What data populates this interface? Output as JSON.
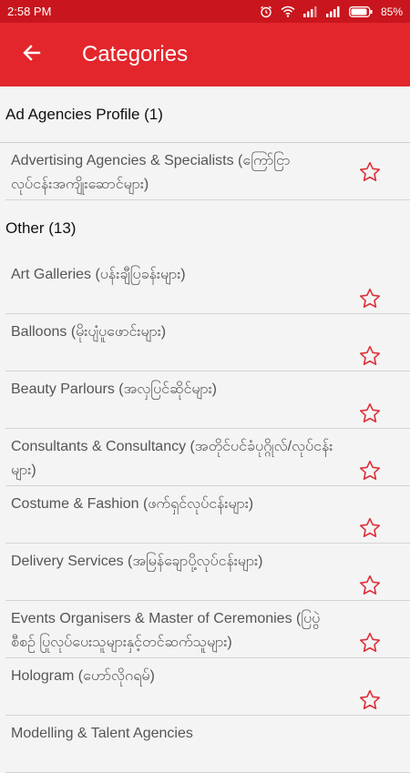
{
  "status_bar": {
    "time": "2:58 PM",
    "battery": "85%"
  },
  "app_bar": {
    "title": "Categories",
    "back_icon": "arrow-left-icon"
  },
  "sections": [
    {
      "header": "Ad Agencies Profile (1)",
      "items": [
        {
          "label": "Advertising Agencies & Specialists (ကြော်ငြာ လုပ်ငန်းအကျိုးဆောင်များ)"
        }
      ]
    },
    {
      "header": "Other (13)",
      "items": [
        {
          "label": "Art Galleries (ပန်းချီပြခန်းများ)"
        },
        {
          "label": "Balloons (မိုးပျံပူဖောင်းများ)"
        },
        {
          "label": "Beauty Parlours (အလှပြင်ဆိုင်များ)"
        },
        {
          "label": "Consultants & Consultancy (အတိုင်ပင်ခံပုဂ္ဂိုလ်/လုပ်ငန်းများ)"
        },
        {
          "label": "Costume & Fashion (ဖက်ရှင်လုပ်ငန်းများ)"
        },
        {
          "label": "Delivery Services (အမြန်ချောပို့လုပ်ငန်းများ)"
        },
        {
          "label": "Events Organisers & Master of Ceremonies (ပြပွဲစီစဉ် ပြုလုပ်ပေးသူများနှင့်တင်ဆက်သူများ)"
        },
        {
          "label": "Hologram (ဟော်လိုဂရမ်)"
        },
        {
          "label": "Modelling & Talent Agencies"
        }
      ]
    }
  ],
  "colors": {
    "status_bar": "#c9151d",
    "app_bar": "#e3262c",
    "star": "#e0303a"
  },
  "icons": {
    "favorite": "star-outline-icon"
  }
}
